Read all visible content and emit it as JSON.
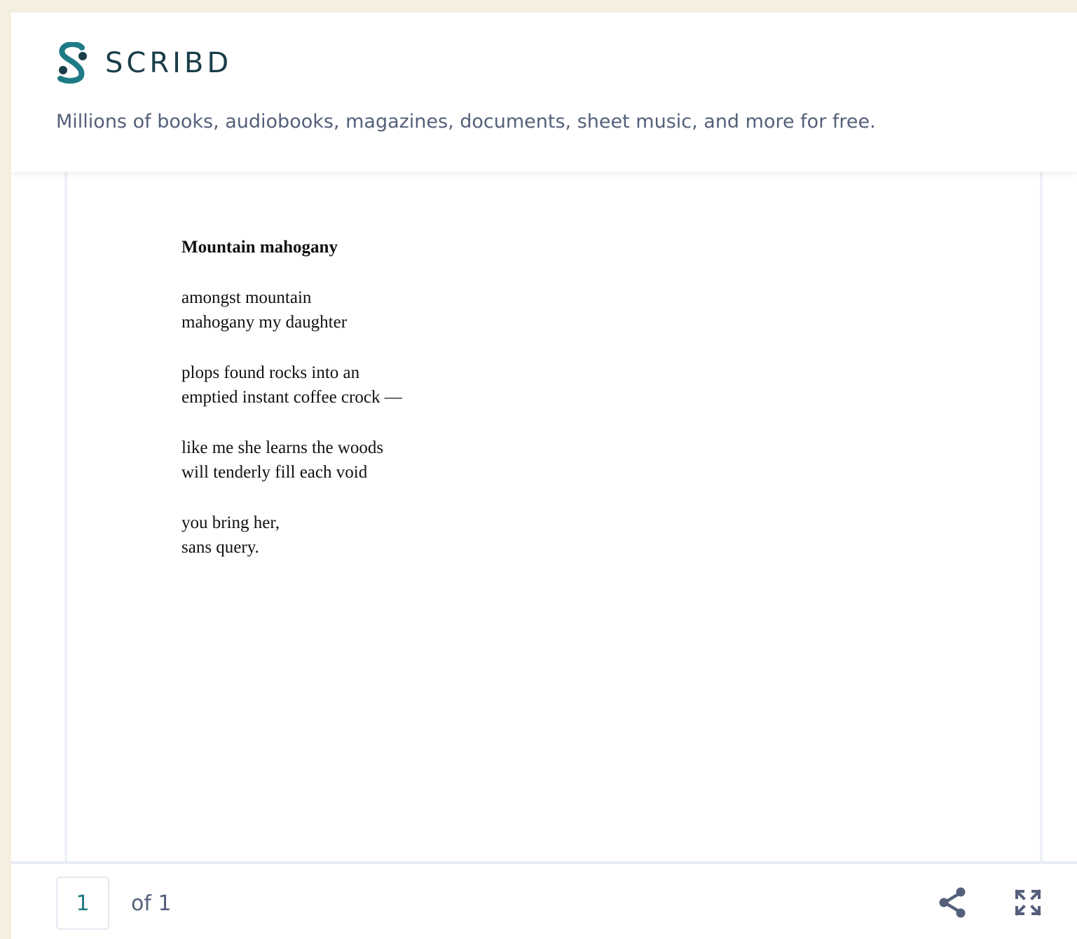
{
  "header": {
    "logo_text": "SCRIBD",
    "tagline": "Millions of books, audiobooks, magazines, documents, sheet music, and more for free."
  },
  "document": {
    "title": "Mountain mahogany",
    "stanzas": [
      [
        "amongst mountain",
        "mahogany my daughter"
      ],
      [
        "plops found rocks into an",
        "emptied instant coffee crock —"
      ],
      [
        "like me she learns the woods",
        "will tenderly fill each void"
      ],
      [
        "you bring her,",
        "sans query."
      ]
    ]
  },
  "footer": {
    "current_page": "1",
    "page_total_label": "of 1",
    "share_icon": "share-icon",
    "fullscreen_icon": "fullscreen-icon"
  },
  "colors": {
    "brand_teal": "#1e7b85",
    "logo_text": "#1b3d4a",
    "muted_text": "#54607a",
    "outer_background": "#f5efe1"
  }
}
